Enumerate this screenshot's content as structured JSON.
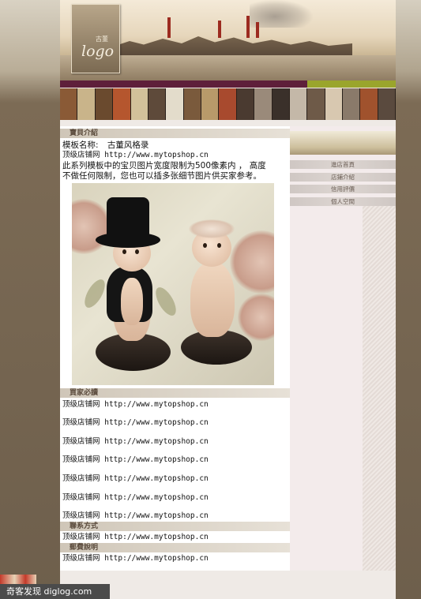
{
  "header": {
    "logo_small": "古董",
    "logo_text": "logo"
  },
  "sections": {
    "intro": {
      "title": "寶貝介紹",
      "template_label": "模板名称:",
      "template_name": "古董风格录",
      "shop_link": "顶级店铺网  http://www.mytopshop.cn",
      "desc_line1": "此系列模板中的宝贝图片宽度限制为500像素内 ， 高度",
      "desc_line2": "不做任何限制，您也可以插多张细节图片供买家参考。"
    },
    "buyer_notice": {
      "title": "買家必讀",
      "links": [
        "顶级店铺网  http://www.mytopshop.cn",
        "顶级店铺网  http://www.mytopshop.cn",
        "顶级店铺网  http://www.mytopshop.cn",
        "顶级店铺网  http://www.mytopshop.cn",
        "顶级店铺网  http://www.mytopshop.cn",
        "顶级店铺网  http://www.mytopshop.cn",
        "顶级店铺网  http://www.mytopshop.cn"
      ]
    },
    "contact": {
      "title": "聯系方式",
      "link": "顶级店铺网  http://www.mytopshop.cn"
    },
    "shipping": {
      "title": "郵費說明",
      "link": "顶级店铺网  http://www.mytopshop.cn"
    }
  },
  "sidebar": {
    "nav": [
      {
        "label": "進店首頁"
      },
      {
        "label": "店鋪介紹"
      },
      {
        "label": "信用評價"
      },
      {
        "label": "個人空間"
      }
    ]
  },
  "watermark": {
    "text": "奇客发现 diglog.com"
  },
  "colors": {
    "band_purple": "#5e1f3a",
    "band_green": "#9aa52c",
    "frame": "#7a6a55"
  }
}
